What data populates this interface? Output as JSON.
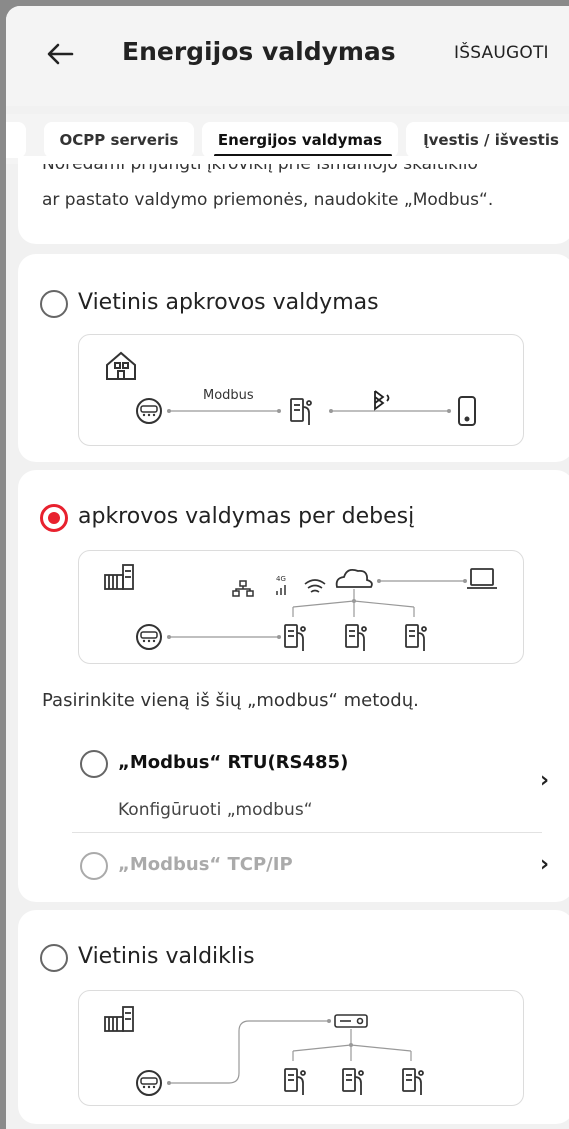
{
  "header": {
    "title": "Energijos valdymas",
    "save_label": "IŠSAUGOTI",
    "back_icon": "arrow-left-icon"
  },
  "tabs": [
    {
      "label": "OCPP serveris",
      "active": false
    },
    {
      "label": "Energijos valdymas",
      "active": true
    },
    {
      "label": "Įvestis / išvestis",
      "active": false
    }
  ],
  "intro": {
    "line1": "Norėdami prijungti įkroviklį prie išmaniojo skaitiklio",
    "line2": "ar pastato valdymo priemonės, naudokite „Modbus“."
  },
  "options": [
    {
      "label": "Vietinis apkrovos valdymas",
      "selected": false,
      "diagram": {
        "link_label": "Modbus"
      }
    },
    {
      "label": "apkrovos valdymas per debesį",
      "selected": true,
      "diagram": {
        "network_label": "4G"
      }
    },
    {
      "label": "Vietinis valdiklis",
      "selected": false
    }
  ],
  "modbus": {
    "prompt": "Pasirinkite vieną iš šių „modbus“ metodų.",
    "methods": [
      {
        "label": "„Modbus“ RTU(RS485)",
        "description": "Konfigūruoti „modbus“",
        "enabled": true,
        "selected": false
      },
      {
        "label": "„Modbus“ TCP/IP",
        "enabled": false,
        "selected": false
      }
    ]
  },
  "colors": {
    "accent": "#e8212e",
    "disabled": "#aaaaaa"
  }
}
